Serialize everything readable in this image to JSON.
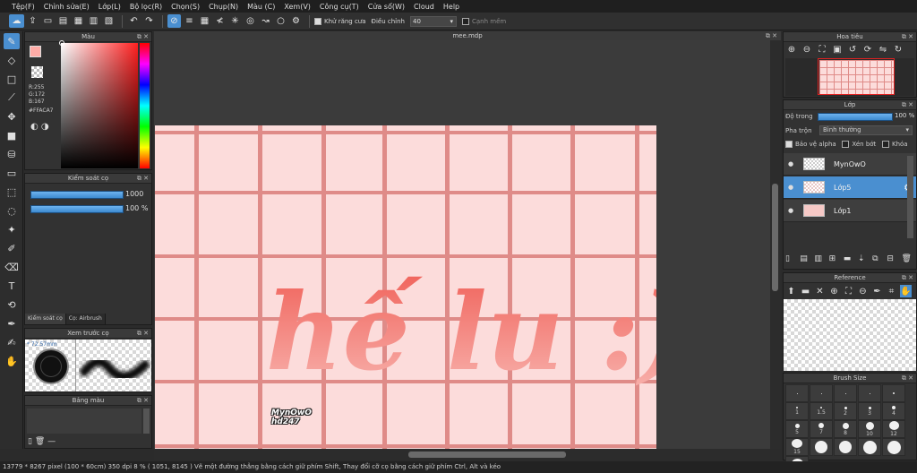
{
  "menu": [
    "Tệp(F)",
    "Chỉnh sửa(E)",
    "Lớp(L)",
    "Bộ lọc(R)",
    "Chọn(S)",
    "Chụp(N)",
    "Màu (C)",
    "Xem(V)",
    "Công cụ(T)",
    "Cửa sổ(W)",
    "Cloud",
    "Help"
  ],
  "toolbar": {
    "antialias_label": "Khử răng cưa",
    "adjust_label": "Điều chỉnh",
    "adjust_value": "40",
    "sharp_label": "Cạnh mềm"
  },
  "colors": {
    "accent": "#4a8fd0",
    "foreground": "#ffaca7",
    "paper": "#fcdcdb",
    "grid": "#df8b88"
  },
  "color_panel": {
    "title": "Màu",
    "r": "R:255",
    "g": "G:172",
    "b": "B:167",
    "hex": "#FFACA7"
  },
  "brush_control": {
    "title": "Kiểm soát cọ",
    "size_value": "1000",
    "opacity_value": "100 %",
    "tab1": "Kiểm soát cọ",
    "tab2": "Cọ: Airbrush"
  },
  "brush_preview": {
    "title": "Xem trước cọ",
    "size_text": "* 72.57mm"
  },
  "swatch": {
    "title": "Bảng màu",
    "dash": "—"
  },
  "document": {
    "title": "mee.mdp",
    "lettering": "hế lu :)",
    "signature_line1": "MynOwO",
    "signature_line2": "hd247"
  },
  "navigator": {
    "title": "Hoa tiêu"
  },
  "layers": {
    "title": "Lớp",
    "opacity_label": "Độ trong",
    "opacity_value": "100 %",
    "blend_label": "Pha trộn",
    "blend_value": "Bình thường",
    "protect_alpha": "Bảo vệ alpha",
    "clipping": "Xén bớt",
    "lock": "Khóa",
    "items": [
      {
        "name": "MynOwO",
        "selected": false
      },
      {
        "name": "Lớp5",
        "selected": true
      },
      {
        "name": "Lớp1",
        "selected": false
      }
    ]
  },
  "reference": {
    "title": "Reference"
  },
  "brush_size": {
    "title": "Brush Size",
    "labels": [
      "1",
      "1.5",
      "2",
      "3",
      "4",
      "5",
      "7",
      "8",
      "10",
      "12",
      "15",
      "20"
    ]
  },
  "status": "13779 * 8267 pixel   (100 * 60cm)   350 dpi   8 %   ( 1051, 8145 )   Vẽ một đường thẳng bằng cách giữ phím Shift, Thay đổi cỡ cọ bằng cách giữ phím Ctrl, Alt và kéo"
}
